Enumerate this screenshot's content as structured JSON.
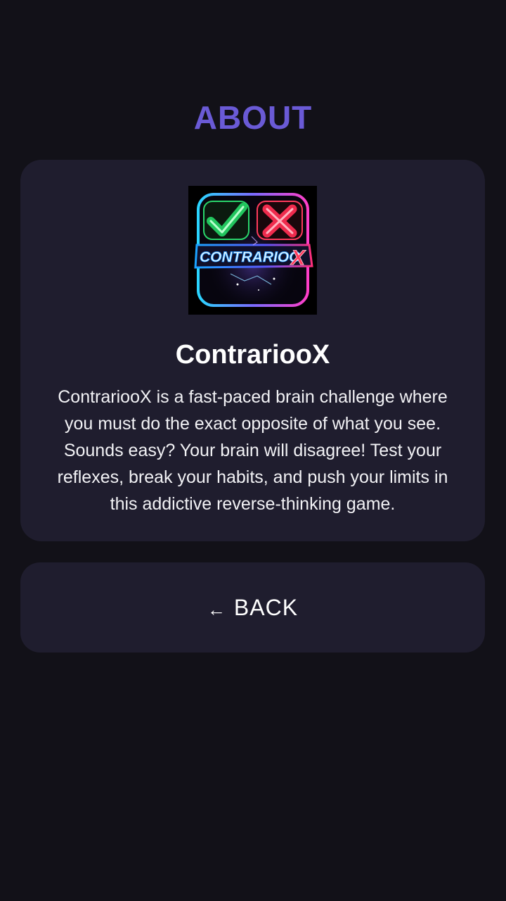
{
  "header": {
    "title": "ABOUT"
  },
  "about_card": {
    "logo": {
      "icon_check": "check-mark-icon",
      "icon_cross": "cross-mark-icon",
      "logo_text_main": "CONTRARIOO",
      "logo_text_x": "X",
      "colors": {
        "check": "#22c55e",
        "cross": "#ef2b4d",
        "frame_left": "#2ad6ff",
        "frame_right": "#ff3ec8"
      }
    },
    "app_name": "ContrariooX",
    "description": "ContrariooX is a fast-paced brain challenge where you must do the exact opposite of what you see. Sounds easy? Your brain will disagree! Test your reflexes, break your habits, and push your limits in this addictive reverse-thinking game."
  },
  "back_button": {
    "arrow": "←",
    "label": "BACK"
  },
  "theme": {
    "background": "#121118",
    "card": "#1f1d2e",
    "accent": "#6a5ad6"
  }
}
